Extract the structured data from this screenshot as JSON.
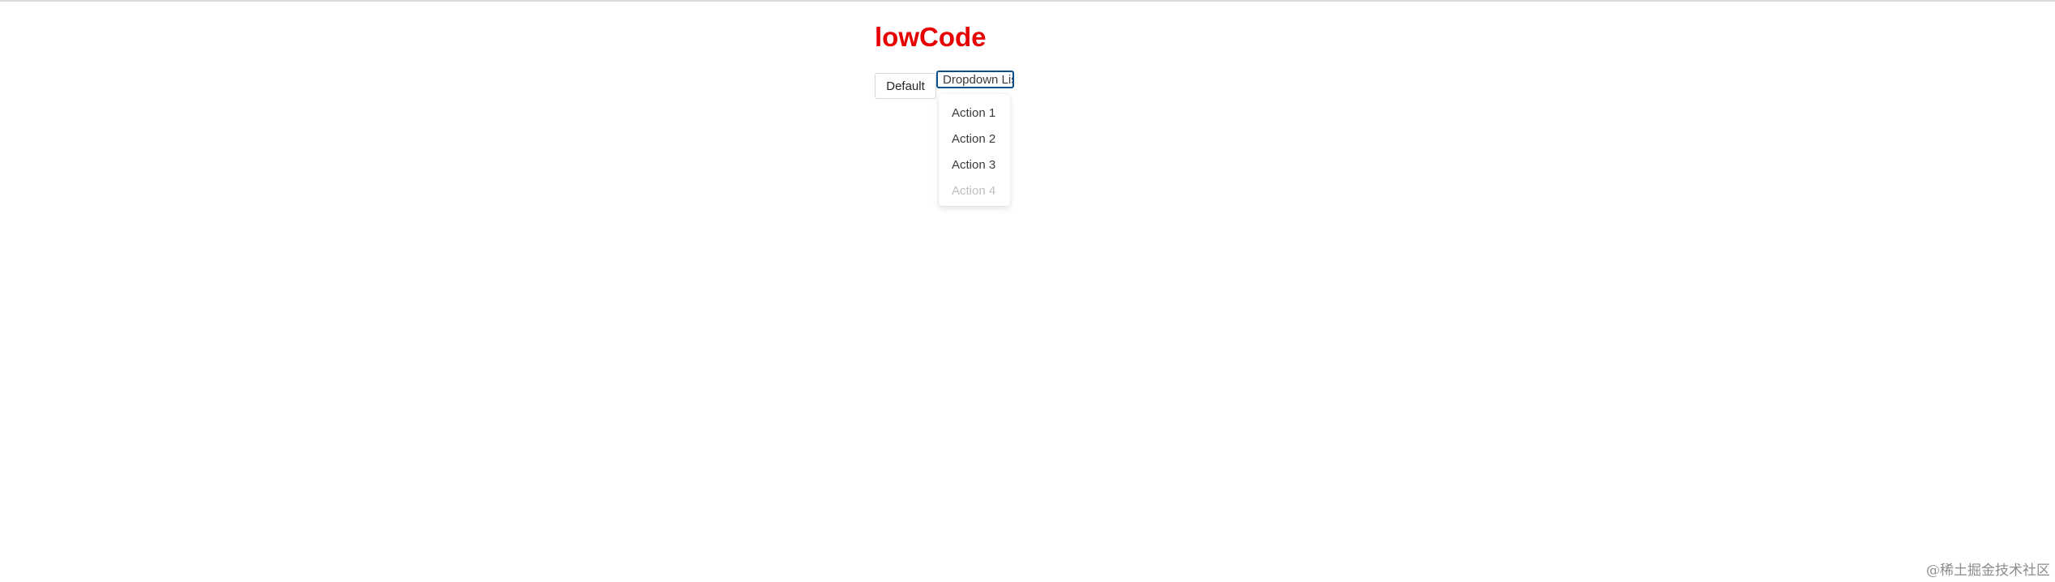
{
  "page": {
    "title": "lowCode"
  },
  "toolbar": {
    "default_label": "Default",
    "dropdown_label": "Dropdown List"
  },
  "dropdown": {
    "items": [
      {
        "label": "Action 1",
        "disabled": false
      },
      {
        "label": "Action 2",
        "disabled": false
      },
      {
        "label": "Action 3",
        "disabled": false
      },
      {
        "label": "Action 4",
        "disabled": true
      }
    ]
  },
  "watermark": {
    "text": "@稀土掘金技术社区"
  },
  "colors": {
    "title": "#e60000",
    "focus_border": "#0b4f8f",
    "disabled_text": "#bfbfbf"
  }
}
